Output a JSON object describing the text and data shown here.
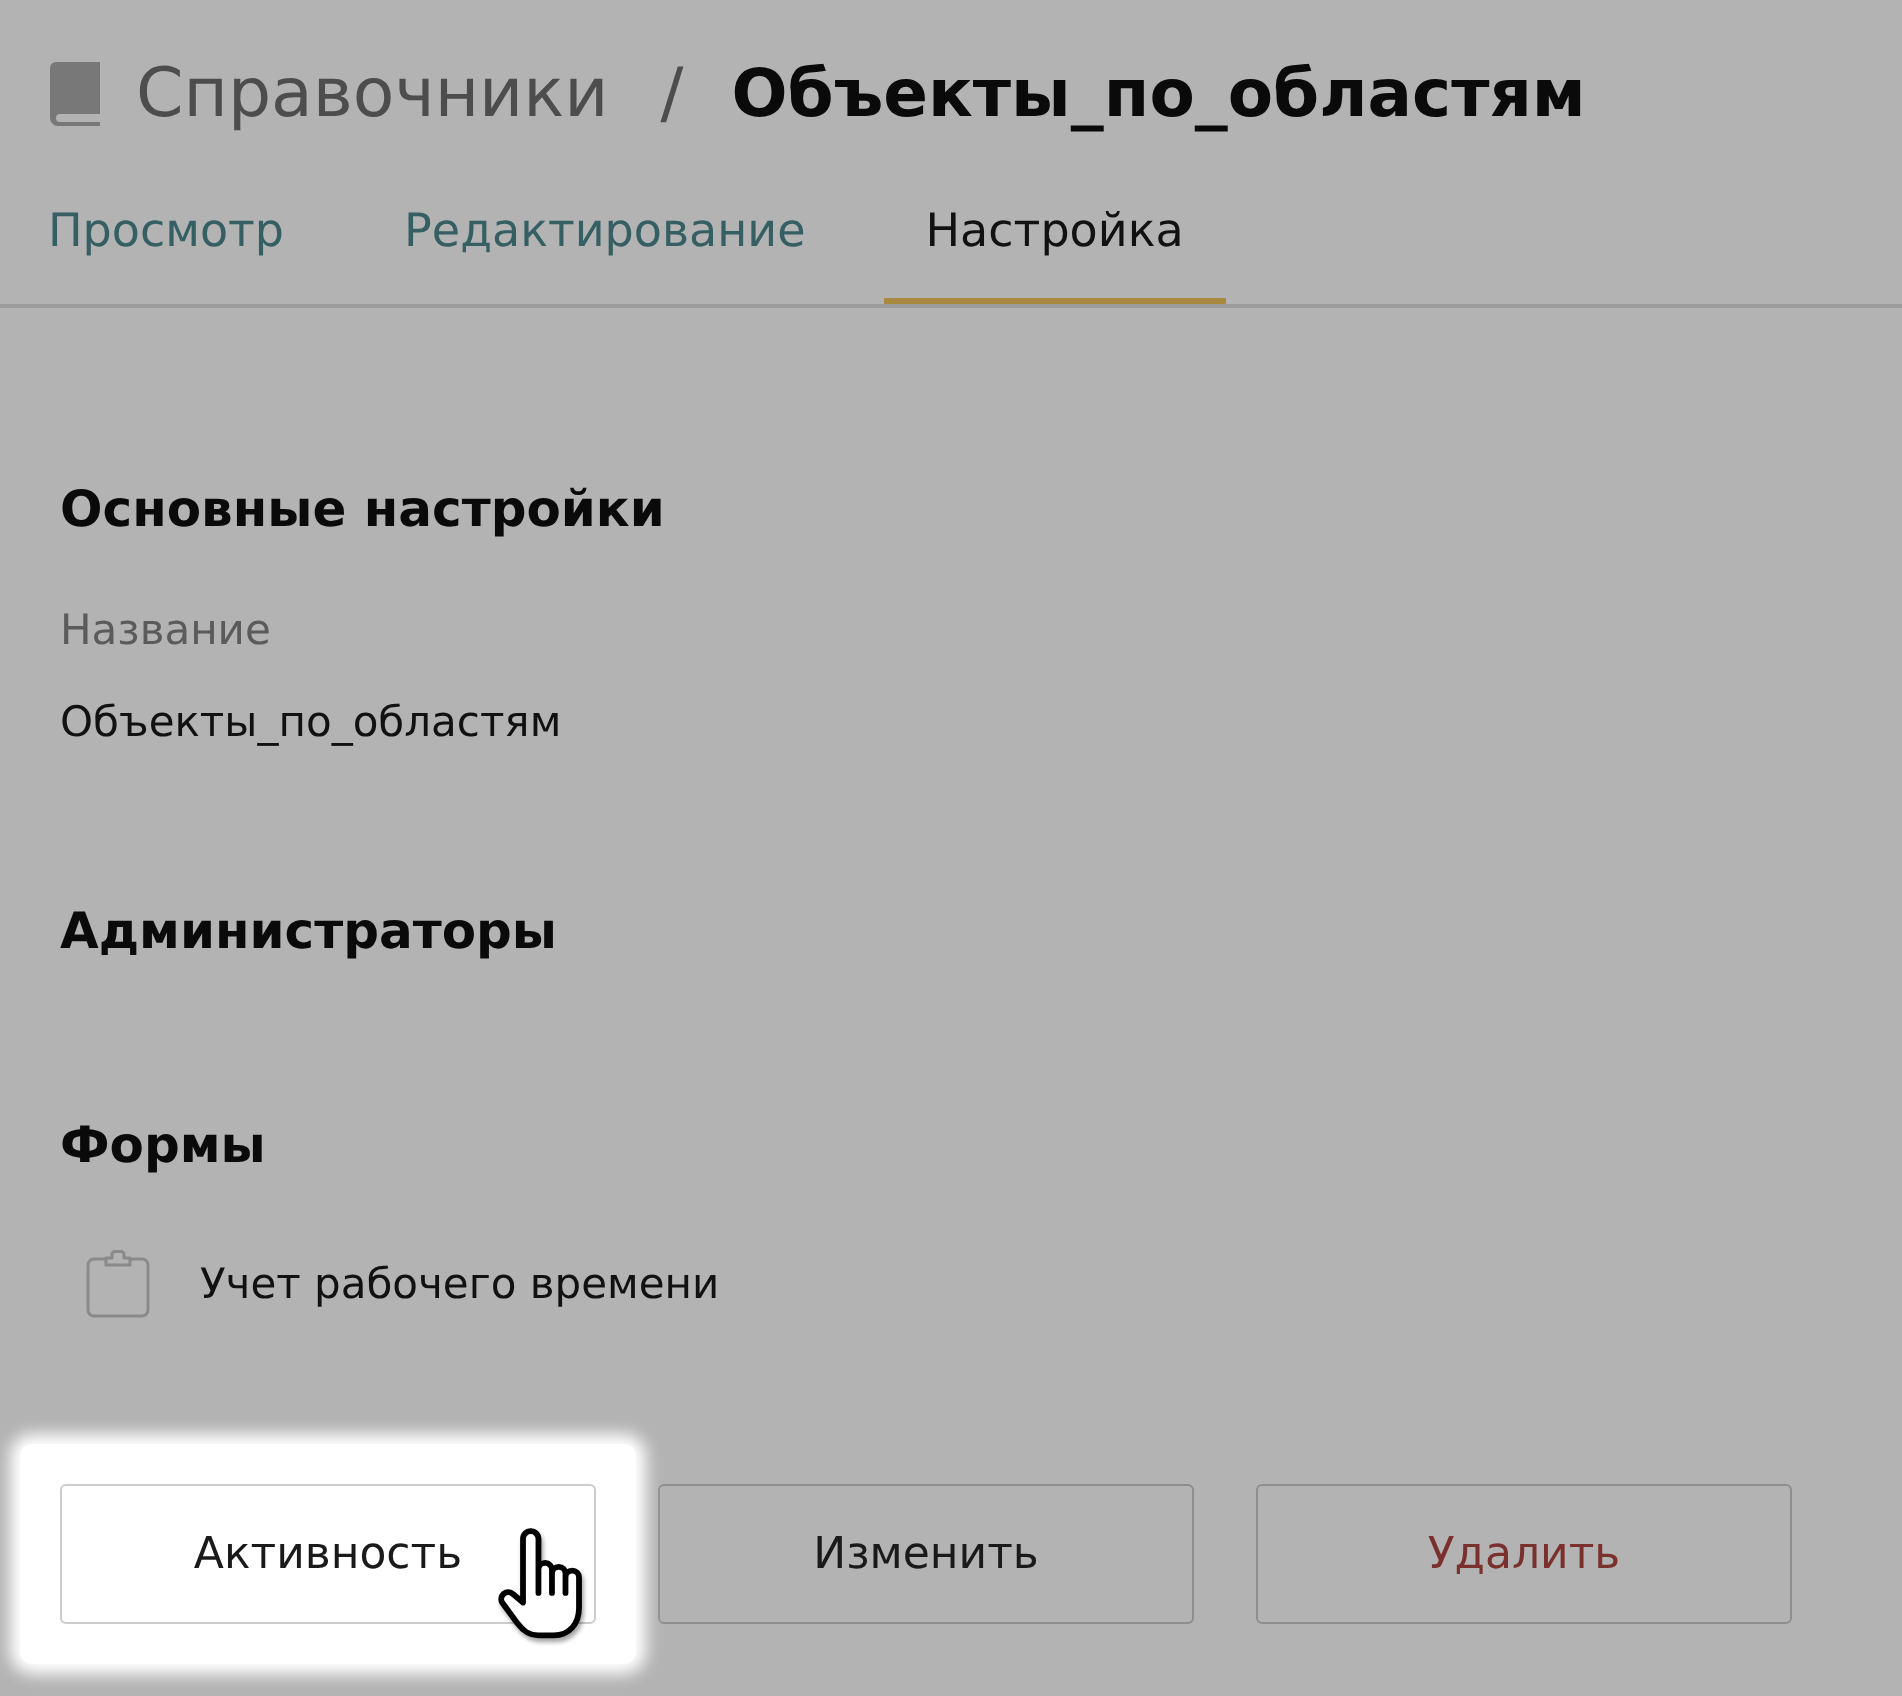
{
  "breadcrumb": {
    "root": "Справочники",
    "separator": "/",
    "current": "Объекты_по_областям"
  },
  "tabs": [
    {
      "label": "Просмотр",
      "selected": false
    },
    {
      "label": "Редактирование",
      "selected": false
    },
    {
      "label": "Настройка",
      "selected": true
    }
  ],
  "sections": [
    {
      "kind": "fields",
      "heading": "Основные настройки",
      "fields": [
        {
          "label": "Название",
          "value": "Объекты_по_областям"
        }
      ]
    },
    {
      "kind": "empty",
      "heading": "Администраторы"
    },
    {
      "kind": "forms",
      "heading": "Формы",
      "items": [
        {
          "label": "Учет рабочего времени"
        }
      ]
    }
  ],
  "buttons": [
    {
      "label": "Активность",
      "kind": "default",
      "highlighted": true
    },
    {
      "label": "Изменить",
      "kind": "default",
      "highlighted": false
    },
    {
      "label": "Удалить",
      "kind": "danger",
      "highlighted": false
    }
  ]
}
